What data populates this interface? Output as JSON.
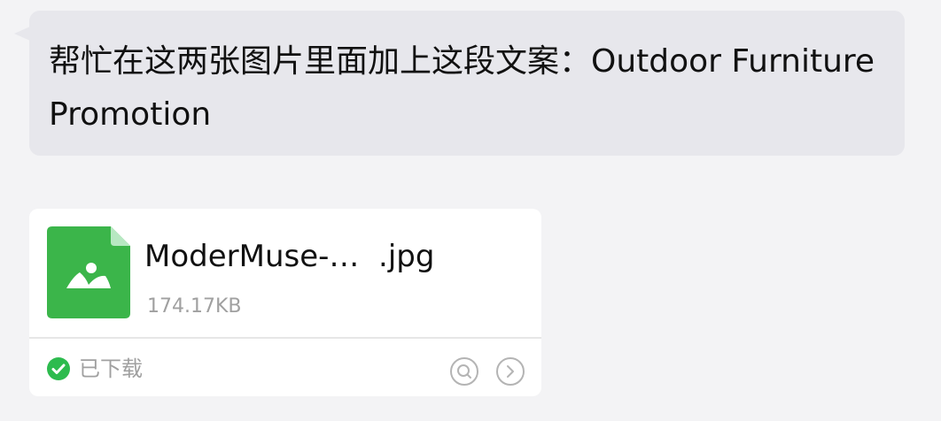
{
  "message": {
    "text": "帮忙在这两张图片里面加上这段文案：Outdoor Furniture Promotion"
  },
  "file_card": {
    "file_name": "ModerMuse-…  .jpg",
    "file_size": "174.17KB",
    "status_text": "已下载",
    "icons": {
      "file": "image-file-icon",
      "status": "check-circle-icon",
      "search": "search-circle-icon",
      "open": "chevron-right-circle-icon"
    },
    "colors": {
      "file_icon": "#3bb54a",
      "status_check": "#2dbb4e"
    }
  }
}
